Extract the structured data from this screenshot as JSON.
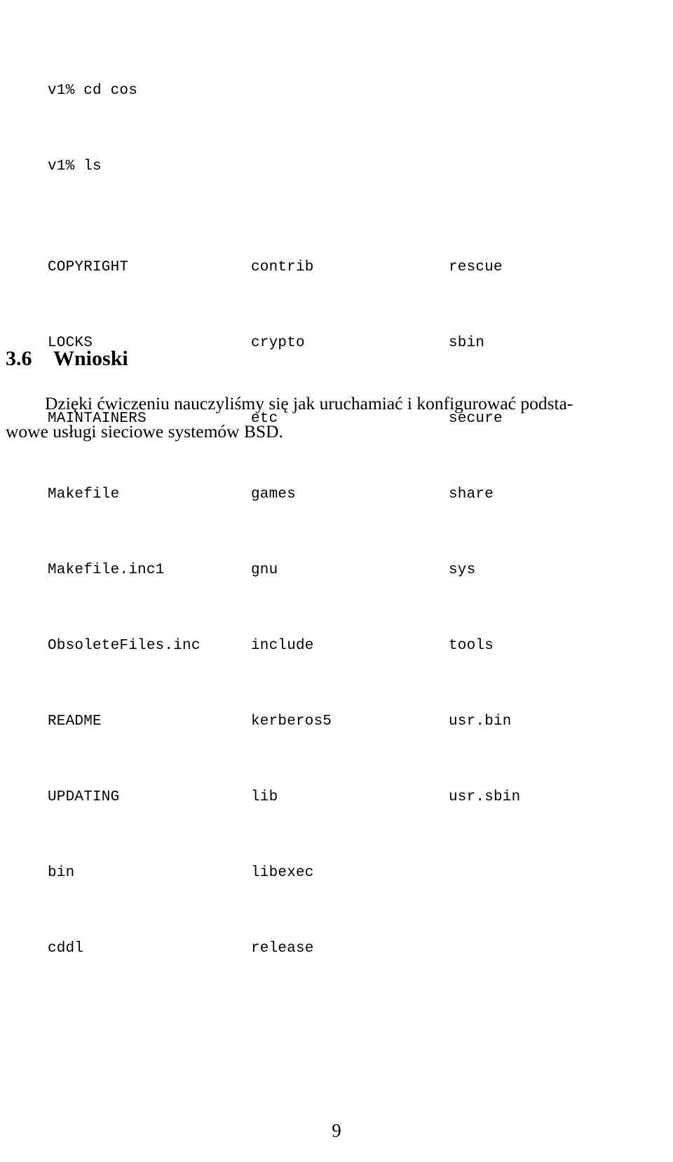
{
  "document": {
    "language": "pl",
    "page_number": "9",
    "background_color": "#ffffff",
    "text_color": "#000000"
  },
  "terminal": {
    "command_lines": [
      "v1% cd cos",
      "v1% ls"
    ],
    "listing_columns": 3,
    "listing_rows": [
      {
        "c1": "COPYRIGHT",
        "c2": "contrib",
        "c3": "rescue"
      },
      {
        "c1": "LOCKS",
        "c2": "crypto",
        "c3": "sbin"
      },
      {
        "c1": "MAINTAINERS",
        "c2": "etc",
        "c3": "secure"
      },
      {
        "c1": "Makefile",
        "c2": "games",
        "c3": "share"
      },
      {
        "c1": "Makefile.inc1",
        "c2": "gnu",
        "c3": "sys"
      },
      {
        "c1": "ObsoleteFiles.inc",
        "c2": "include",
        "c3": "tools"
      },
      {
        "c1": "README",
        "c2": "kerberos5",
        "c3": "usr.bin"
      },
      {
        "c1": "UPDATING",
        "c2": "lib",
        "c3": "usr.sbin"
      },
      {
        "c1": "bin",
        "c2": "libexec",
        "c3": ""
      },
      {
        "c1": "cddl",
        "c2": "release",
        "c3": ""
      }
    ]
  },
  "section": {
    "number": "3.6",
    "title": "Wnioski"
  },
  "paragraph": {
    "lines": [
      "Dzięki ćwiczeniu nauczyliśmy się jak uruchamiać i konfigurować podsta-",
      "wowe usługi sieciowe systemów BSD."
    ],
    "full_text": "Dzięki ćwiczeniu nauczyliśmy się jak uruchamiać i konfigurować podstawowe usługi sieciowe systemów BSD."
  },
  "footer": {
    "page_number": "9"
  }
}
